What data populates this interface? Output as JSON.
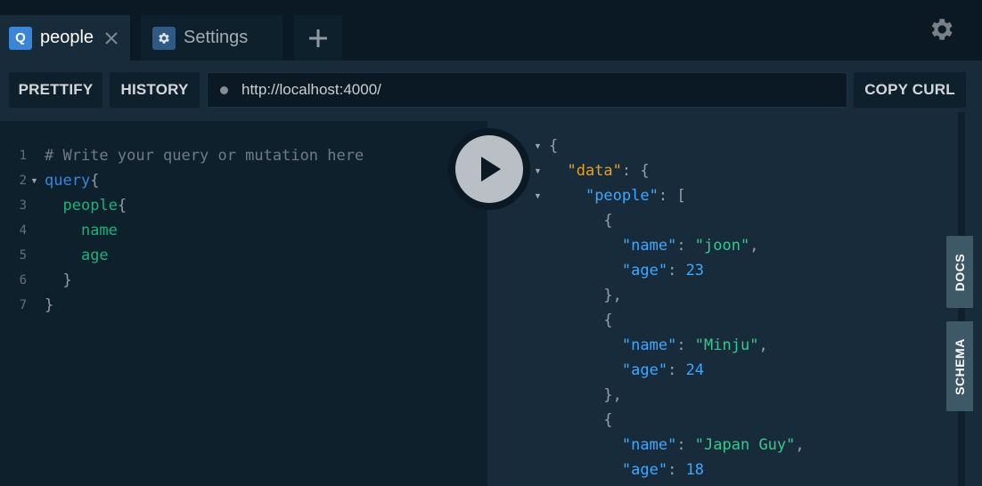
{
  "tabs": [
    {
      "badge": "Q",
      "label": "people",
      "active": true
    },
    {
      "label": "Settings",
      "active": false
    }
  ],
  "toolbar": {
    "prettify": "PRETTIFY",
    "history": "HISTORY",
    "url": "http://localhost:4000/",
    "copy_curl": "COPY CURL"
  },
  "editor": {
    "line_numbers": [
      "1",
      "2",
      "3",
      "4",
      "5",
      "6",
      "7"
    ],
    "lines": [
      {
        "indent": "",
        "tokens": [
          {
            "t": "# Write your query or mutation here",
            "c": "comment"
          }
        ]
      },
      {
        "indent": "",
        "tokens": [
          {
            "t": "query",
            "c": "kw"
          },
          {
            "t": "{",
            "c": "punct"
          }
        ]
      },
      {
        "indent": "  ",
        "tokens": [
          {
            "t": "people",
            "c": "field"
          },
          {
            "t": "{",
            "c": "punct"
          }
        ]
      },
      {
        "indent": "    ",
        "tokens": [
          {
            "t": "name",
            "c": "field"
          }
        ]
      },
      {
        "indent": "    ",
        "tokens": [
          {
            "t": "age",
            "c": "field"
          }
        ]
      },
      {
        "indent": "  ",
        "tokens": [
          {
            "t": "}",
            "c": "punct"
          }
        ]
      },
      {
        "indent": "",
        "tokens": [
          {
            "t": "}",
            "c": "punct"
          }
        ]
      }
    ]
  },
  "results": {
    "lines": [
      {
        "indent": "",
        "tokens": [
          {
            "t": "{",
            "c": "punct"
          }
        ]
      },
      {
        "indent": "  ",
        "tokens": [
          {
            "t": "\"data\"",
            "c": "data"
          },
          {
            "t": ": {",
            "c": "punct"
          }
        ]
      },
      {
        "indent": "    ",
        "tokens": [
          {
            "t": "\"people\"",
            "c": "key"
          },
          {
            "t": ": [",
            "c": "punct"
          }
        ]
      },
      {
        "indent": "      ",
        "tokens": [
          {
            "t": "{",
            "c": "punct"
          }
        ]
      },
      {
        "indent": "        ",
        "tokens": [
          {
            "t": "\"name\"",
            "c": "key"
          },
          {
            "t": ": ",
            "c": "punct"
          },
          {
            "t": "\"joon\"",
            "c": "str"
          },
          {
            "t": ",",
            "c": "punct"
          }
        ]
      },
      {
        "indent": "        ",
        "tokens": [
          {
            "t": "\"age\"",
            "c": "key"
          },
          {
            "t": ": ",
            "c": "punct"
          },
          {
            "t": "23",
            "c": "num"
          }
        ]
      },
      {
        "indent": "      ",
        "tokens": [
          {
            "t": "},",
            "c": "punct"
          }
        ]
      },
      {
        "indent": "      ",
        "tokens": [
          {
            "t": "{",
            "c": "punct"
          }
        ]
      },
      {
        "indent": "        ",
        "tokens": [
          {
            "t": "\"name\"",
            "c": "key"
          },
          {
            "t": ": ",
            "c": "punct"
          },
          {
            "t": "\"Minju\"",
            "c": "str"
          },
          {
            "t": ",",
            "c": "punct"
          }
        ]
      },
      {
        "indent": "        ",
        "tokens": [
          {
            "t": "\"age\"",
            "c": "key"
          },
          {
            "t": ": ",
            "c": "punct"
          },
          {
            "t": "24",
            "c": "num"
          }
        ]
      },
      {
        "indent": "      ",
        "tokens": [
          {
            "t": "},",
            "c": "punct"
          }
        ]
      },
      {
        "indent": "      ",
        "tokens": [
          {
            "t": "{",
            "c": "punct"
          }
        ]
      },
      {
        "indent": "        ",
        "tokens": [
          {
            "t": "\"name\"",
            "c": "key"
          },
          {
            "t": ": ",
            "c": "punct"
          },
          {
            "t": "\"Japan Guy\"",
            "c": "str"
          },
          {
            "t": ",",
            "c": "punct"
          }
        ]
      },
      {
        "indent": "        ",
        "tokens": [
          {
            "t": "\"age\"",
            "c": "key"
          },
          {
            "t": ": ",
            "c": "punct"
          },
          {
            "t": "18",
            "c": "num"
          }
        ]
      }
    ]
  },
  "side_tabs": {
    "docs": "DOCS",
    "schema": "SCHEMA"
  },
  "icons": {
    "close": "close-icon",
    "settings": "gear-icon",
    "add": "plus-icon",
    "run": "play-icon"
  },
  "colors": {
    "accent": "#3b85d6",
    "string": "#36c98e",
    "data_key": "#e8a11e",
    "key": "#3ea7ff"
  }
}
